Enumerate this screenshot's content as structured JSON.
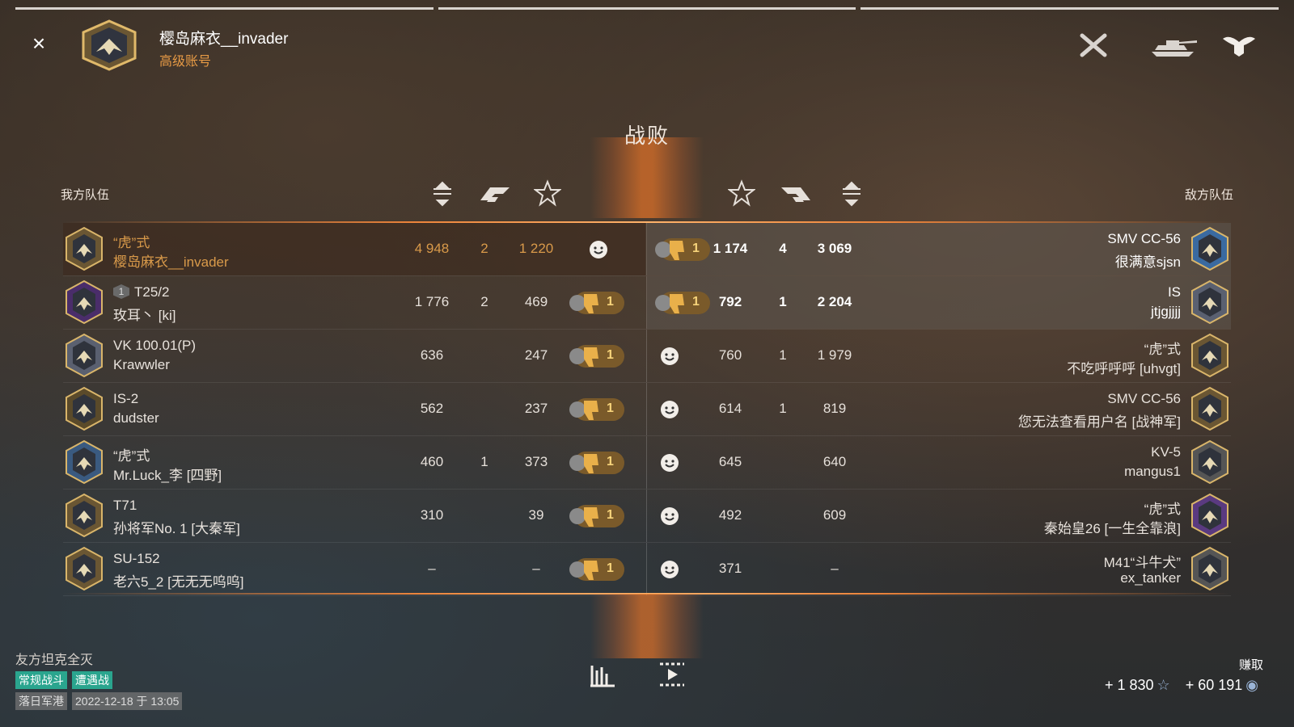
{
  "header": {
    "player_name": "樱岛麻衣__invader",
    "account_type": "高级账号",
    "close_label": "×",
    "icons": [
      "battle-crossed-swords-icon",
      "tank-icon",
      "clan-eagle-icon"
    ]
  },
  "battle": {
    "result": "战败",
    "ally_label": "我方队伍",
    "enemy_label": "敌方队伍"
  },
  "columns": {
    "left": [
      "damage-sort-icon",
      "kills-icon",
      "experience-star-icon"
    ],
    "right": [
      "experience-star-icon",
      "kills-icon",
      "damage-sort-icon"
    ]
  },
  "allies": [
    {
      "tank": "“虎”式",
      "nick": "樱岛麻衣__invader",
      "damage": "4 948",
      "kills": "2",
      "xp": "1 220",
      "reaction": "smile",
      "self": true
    },
    {
      "tank": "T25/2",
      "tier_badge": "1",
      "nick": "玫耳丶 [ki]",
      "damage": "1 776",
      "kills": "2",
      "xp": "469",
      "reaction": "dislike",
      "reaction_count": "1"
    },
    {
      "tank": "VK 100.01(P)",
      "nick": "Krawwler",
      "damage": "636",
      "kills": "",
      "xp": "247",
      "reaction": "dislike",
      "reaction_count": "1"
    },
    {
      "tank": "IS-2",
      "nick": "dudster",
      "damage": "562",
      "kills": "",
      "xp": "237",
      "reaction": "dislike",
      "reaction_count": "1"
    },
    {
      "tank": "“虎”式",
      "nick": "Mr.Luck_李 [四野]",
      "damage": "460",
      "kills": "1",
      "xp": "373",
      "reaction": "dislike",
      "reaction_count": "1"
    },
    {
      "tank": "T71",
      "nick": "孙将军No. 1 [大秦军]",
      "damage": "310",
      "kills": "",
      "xp": "39",
      "reaction": "dislike",
      "reaction_count": "1"
    },
    {
      "tank": "SU-152",
      "nick": "老六5_2 [无无无呜呜]",
      "damage": "–",
      "kills": "",
      "xp": "–",
      "reaction": "dislike",
      "reaction_count": "1"
    }
  ],
  "enemies": [
    {
      "tank": "SMV CC-56",
      "nick": "很满意sjsn",
      "xp": "1 174",
      "kills": "4",
      "damage": "3 069",
      "reaction": "dislike",
      "reaction_count": "1"
    },
    {
      "tank": "IS",
      "nick": "jtjgjjjj",
      "xp": "792",
      "kills": "1",
      "damage": "2 204",
      "reaction": "dislike",
      "reaction_count": "1"
    },
    {
      "tank": "“虎”式",
      "nick": "不吃呼呼呼 [uhvgt]",
      "xp": "760",
      "kills": "1",
      "damage": "1 979",
      "reaction": "smile"
    },
    {
      "tank": "SMV CC-56",
      "nick": "您无法查看用户名 [战神军]",
      "xp": "614",
      "kills": "1",
      "damage": "819",
      "reaction": "smile"
    },
    {
      "tank": "KV-5",
      "nick": "mangus1",
      "xp": "645",
      "kills": "",
      "damage": "640",
      "reaction": "smile"
    },
    {
      "tank": "“虎”式",
      "nick": "秦始皇26 [一生全靠浪]",
      "xp": "492",
      "kills": "",
      "damage": "609",
      "reaction": "smile"
    },
    {
      "tank": "M41“斗牛犬”",
      "nick": "ex_tanker",
      "xp": "371",
      "kills": "",
      "damage": "–",
      "reaction": "smile"
    }
  ],
  "footer": {
    "status": "友方坦克全灭",
    "mode": "常规战斗",
    "type": "遭遇战",
    "map": "落日军港",
    "datetime": "2022-12-18 于 13:05",
    "earned_label": "赚取",
    "xp_earned": "+ 1 830",
    "credits_earned": "+ 60 191"
  },
  "colors": {
    "accent_orange": "#d99a4a",
    "teal_tag": "#2aa58e",
    "dislike_gold": "#e9b04a"
  }
}
